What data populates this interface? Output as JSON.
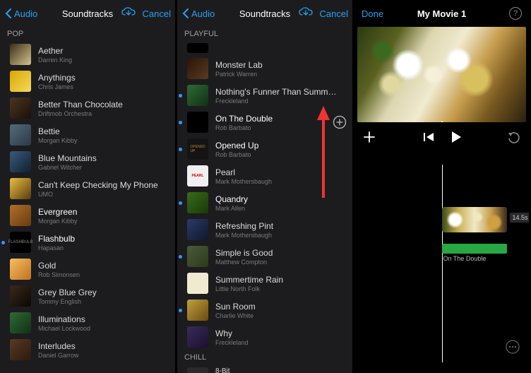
{
  "nav_back_label": "Audio",
  "nav_title": "Soundtracks",
  "nav_cancel": "Cancel",
  "p1_section": "POP",
  "p2_section_top": "PLAYFUL",
  "p2_section_bottom": "CHILL",
  "p3_done": "Done",
  "p3_title": "My Movie 1",
  "p3_clip_duration": "14.5s",
  "p3_audio_label": "On The Double",
  "p1_tracks": [
    {
      "title": "Aether",
      "artist": "Darren King"
    },
    {
      "title": "Anythings",
      "artist": "Chris James"
    },
    {
      "title": "Better Than Chocolate",
      "artist": "Driftmob Orchestra"
    },
    {
      "title": "Bettie",
      "artist": "Morgan Kibby"
    },
    {
      "title": "Blue Mountains",
      "artist": "Gabriel Witcher"
    },
    {
      "title": "Can't Keep Checking My Phone",
      "artist": "UMO"
    },
    {
      "title": "Evergreen",
      "artist": "Morgan Kibby"
    },
    {
      "title": "Flashbulb",
      "artist": "Hapasan"
    },
    {
      "title": "Gold",
      "artist": "Rob Simonsen"
    },
    {
      "title": "Grey Blue Grey",
      "artist": "Tommy English"
    },
    {
      "title": "Illuminations",
      "artist": "Michael Lockwood"
    },
    {
      "title": "Interludes",
      "artist": "Daniel Garrow"
    }
  ],
  "p2_tracks": [
    {
      "title": "Monster Lab",
      "artist": "Patrick Warren"
    },
    {
      "title": "Nothing's Funner Than Summ…",
      "artist": "Freckleland"
    },
    {
      "title": "On The Double",
      "artist": "Rob Barbato"
    },
    {
      "title": "Opened Up",
      "artist": "Rob Barbato"
    },
    {
      "title": "Pearl",
      "artist": "Mark Mothersbaugh"
    },
    {
      "title": "Quandry",
      "artist": "Mark Allen"
    },
    {
      "title": "Refreshing Pint",
      "artist": "Mark Mothersbaugh"
    },
    {
      "title": "Simple is Good",
      "artist": "Matthew Compton"
    },
    {
      "title": "Summertime Rain",
      "artist": "Little North Folk"
    },
    {
      "title": "Sun Room",
      "artist": "Charlie White"
    },
    {
      "title": "Why",
      "artist": "Freckleland"
    }
  ],
  "p2_tracks_b": [
    {
      "title": "8-Bit",
      "artist": ""
    }
  ]
}
